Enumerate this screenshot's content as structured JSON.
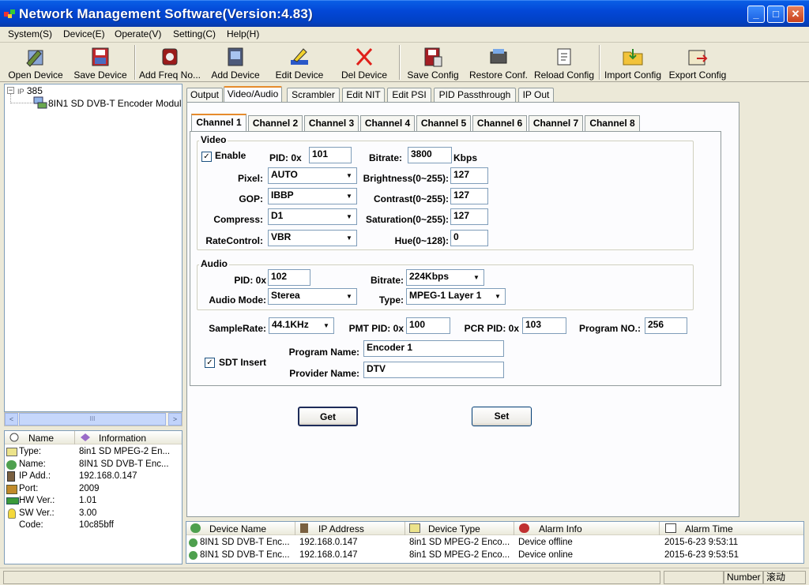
{
  "window": {
    "title": "Network Management Software(Version:4.83)"
  },
  "menu": [
    "System(S)",
    "Device(E)",
    "Operate(V)",
    "Setting(C)",
    "Help(H)"
  ],
  "toolbar": [
    "Open Device",
    "Save Device",
    "Add Freq No...",
    "Add Device",
    "Edit Device",
    "Del Device",
    "Save Config",
    "Restore Conf.",
    "Reload Config",
    "Import Config",
    "Export Config"
  ],
  "tree": {
    "root": "385",
    "root_prefix": "IP",
    "child": "8IN1 SD DVB-T Encoder Modula"
  },
  "info": {
    "headers": [
      "Name",
      "Information"
    ],
    "rows": [
      {
        "name": "Type:",
        "value": "8in1 SD MPEG-2 En..."
      },
      {
        "name": "Name:",
        "value": "8IN1 SD DVB-T Enc..."
      },
      {
        "name": "IP Add.:",
        "value": "192.168.0.147"
      },
      {
        "name": "Port:",
        "value": "2009"
      },
      {
        "name": "HW Ver.:",
        "value": "1.01"
      },
      {
        "name": "SW Ver.:",
        "value": "3.00"
      },
      {
        "name": "Code:",
        "value": "10c85bff"
      }
    ]
  },
  "tabs": [
    "Output",
    "Video/Audio",
    "Scrambler",
    "Edit NIT",
    "Edit PSI",
    "PID Passthrough",
    "IP Out"
  ],
  "active_tab": "Video/Audio",
  "channels": [
    "Channel 1",
    "Channel 2",
    "Channel 3",
    "Channel 4",
    "Channel 5",
    "Channel 6",
    "Channel 7",
    "Channel 8"
  ],
  "video": {
    "group": "Video",
    "enable_label": "Enable",
    "enable_check": "✓",
    "pid_label": "PID: 0x",
    "pid": "101",
    "bitrate_label": "Bitrate:",
    "bitrate": "3800",
    "bitrate_unit": "Kbps",
    "pixel_label": "Pixel:",
    "pixel": "AUTO",
    "gop_label": "GOP:",
    "gop": "IBBP",
    "compress_label": "Compress:",
    "compress": "D1",
    "ratecontrol_label": "RateControl:",
    "ratecontrol": "VBR",
    "brightness_label": "Brightness(0~255):",
    "brightness": "127",
    "contrast_label": "Contrast(0~255):",
    "contrast": "127",
    "saturation_label": "Saturation(0~255):",
    "saturation": "127",
    "hue_label": "Hue(0~128):",
    "hue": "0"
  },
  "audio": {
    "group": "Audio",
    "pid_label": "PID: 0x",
    "pid": "102",
    "bitrate_label": "Bitrate:",
    "bitrate": "224Kbps",
    "mode_label": "Audio Mode:",
    "mode": "Sterea",
    "type_label": "Type:",
    "type": "MPEG-1 Layer 1"
  },
  "misc": {
    "samplerate_label": "SampleRate:",
    "samplerate": "44.1KHz",
    "pmt_label": "PMT PID: 0x",
    "pmt": "100",
    "pcr_label": "PCR PID: 0x",
    "pcr": "103",
    "program_no_label": "Program NO.:",
    "program_no": "256",
    "sdt_label": "SDT Insert",
    "sdt_check": "✓",
    "program_name_label": "Program Name:",
    "program_name": "Encoder 1",
    "provider_name_label": "Provider Name:",
    "provider_name": "DTV"
  },
  "buttons": {
    "get": "Get",
    "set": "Set"
  },
  "alarm": {
    "headers": [
      "Device Name",
      "IP Address",
      "Device Type",
      "Alarm Info",
      "Alarm Time"
    ],
    "rows": [
      [
        "8IN1 SD DVB-T Enc...",
        "192.168.0.147",
        "8in1 SD MPEG-2 Enco...",
        "Device offline",
        "2015-6-23 9:53:11"
      ],
      [
        "8IN1 SD DVB-T Enc...",
        "192.168.0.147",
        "8in1 SD MPEG-2 Enco...",
        "Device online",
        "2015-6-23 9:53:51"
      ]
    ]
  },
  "status": {
    "number": "Number",
    "scroll": "滚动"
  },
  "scroll": {
    "left": "<",
    "right": ">",
    "thumb": "III"
  }
}
